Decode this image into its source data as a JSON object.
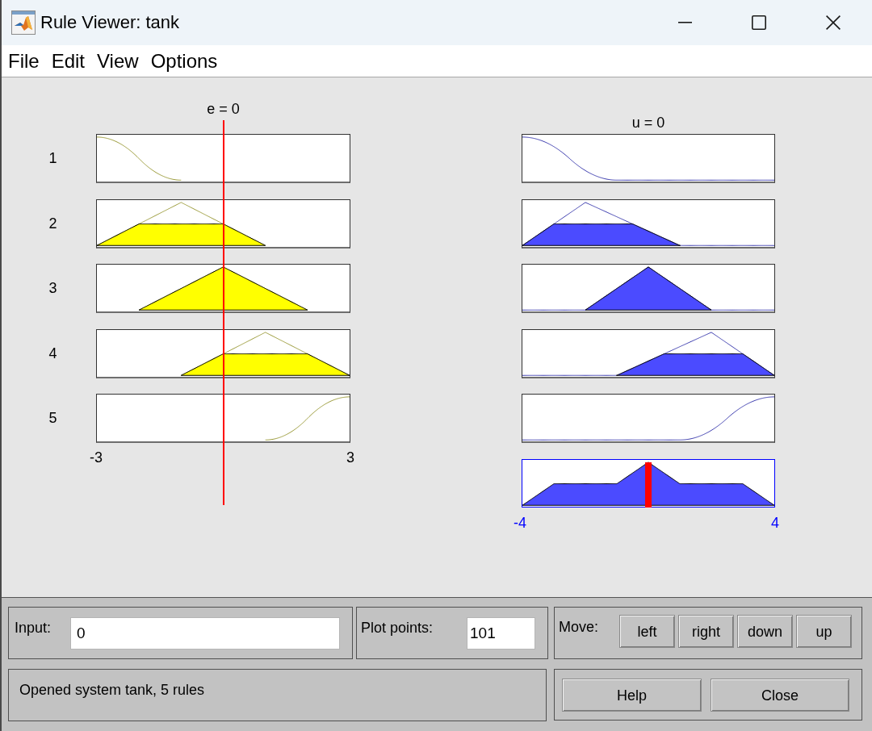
{
  "window": {
    "title": "Rule Viewer: tank"
  },
  "menu": [
    "File",
    "Edit",
    "View",
    "Options"
  ],
  "input_plot": {
    "title": "e = 0",
    "tick_min": "-3",
    "tick_max": "3",
    "marker": {
      "level": 0.5
    }
  },
  "output_plot": {
    "title": "u = 0",
    "tick_min": "-4",
    "tick_max": "4",
    "marker": {
      "level": 0.5
    }
  },
  "rules": [
    {
      "number": "1",
      "kind": "zshape"
    },
    {
      "number": "2",
      "kind": "triangle"
    },
    {
      "number": "3",
      "kind": "triangle"
    },
    {
      "number": "4",
      "kind": "triangle"
    },
    {
      "number": "5",
      "kind": "sshape"
    }
  ],
  "input_field": {
    "label": "Input:",
    "value": "0"
  },
  "plot_points": {
    "label": "Plot points:",
    "value": "101"
  },
  "move": {
    "label": "Move:",
    "buttons": [
      "left",
      "right",
      "down",
      "up"
    ]
  },
  "status": "Opened system tank, 5 rules",
  "buttons": [
    "Help",
    "Close"
  ]
}
